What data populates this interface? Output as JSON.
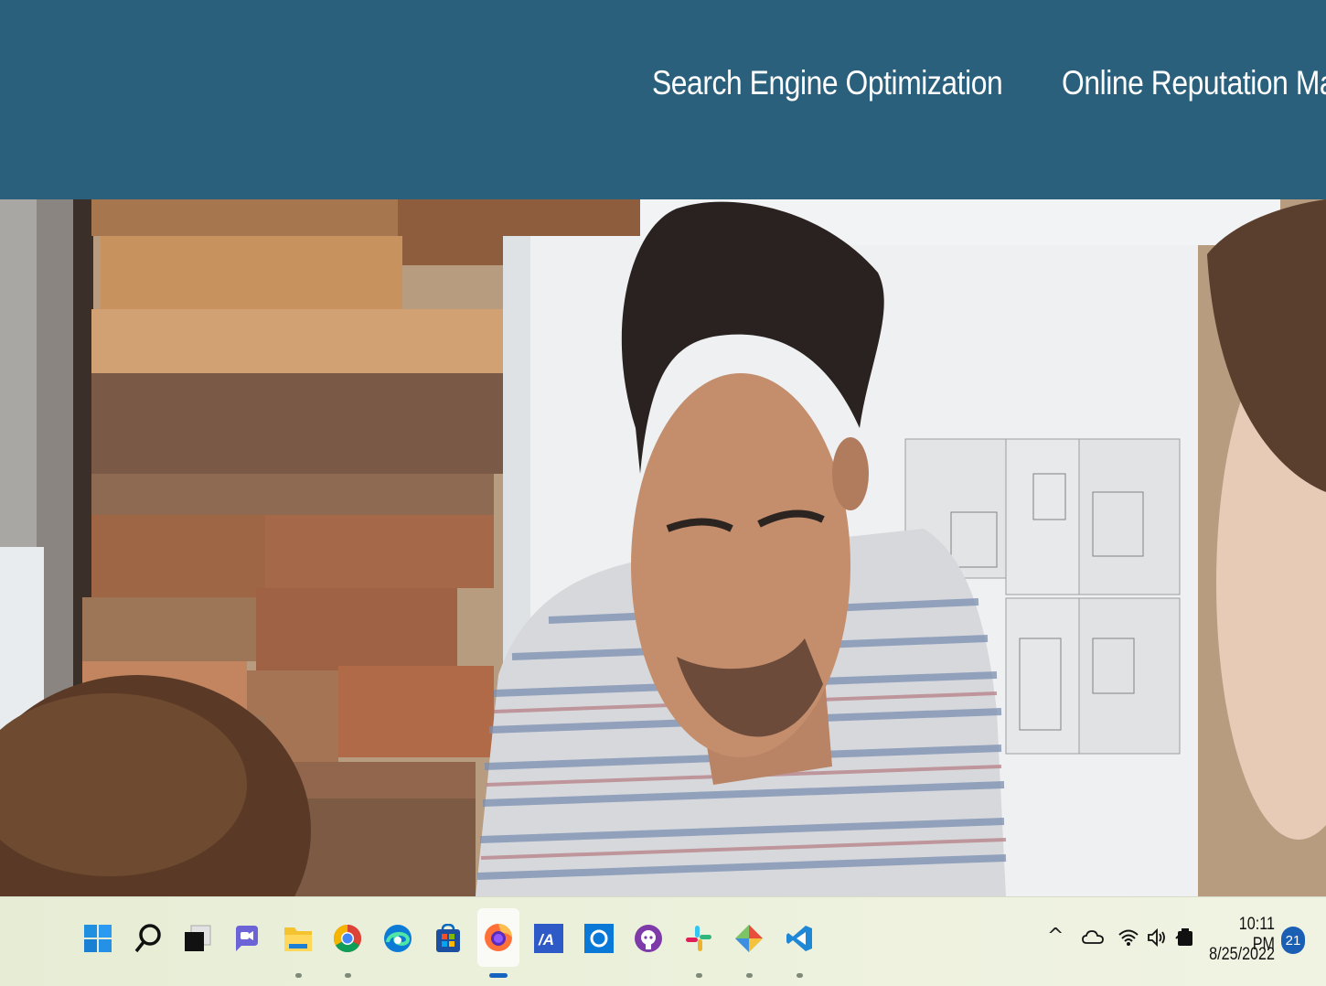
{
  "nav": {
    "items": [
      {
        "label": "Search Engine Optimization"
      },
      {
        "label": "Online Reputation Manage"
      }
    ]
  },
  "hero": {
    "image": "office-team-photo"
  },
  "taskbar": {
    "apps": [
      {
        "name": "start-icon"
      },
      {
        "name": "search-icon"
      },
      {
        "name": "task-view-icon"
      },
      {
        "name": "teams-chat-icon"
      },
      {
        "name": "file-explorer-icon"
      },
      {
        "name": "chrome-icon"
      },
      {
        "name": "edge-icon"
      },
      {
        "name": "store-icon"
      },
      {
        "name": "firefox-icon"
      },
      {
        "name": "ma-app-icon"
      },
      {
        "name": "cortana-icon"
      },
      {
        "name": "github-icon"
      },
      {
        "name": "slack-icon"
      },
      {
        "name": "git-icon"
      },
      {
        "name": "vscode-icon"
      }
    ],
    "tray": {
      "time": "10:11 PM",
      "date": "8/25/2022",
      "notifications": "21"
    }
  },
  "colors": {
    "header": "#2a607c",
    "taskbar": "#eaf0da",
    "accent": "#1565c0"
  }
}
